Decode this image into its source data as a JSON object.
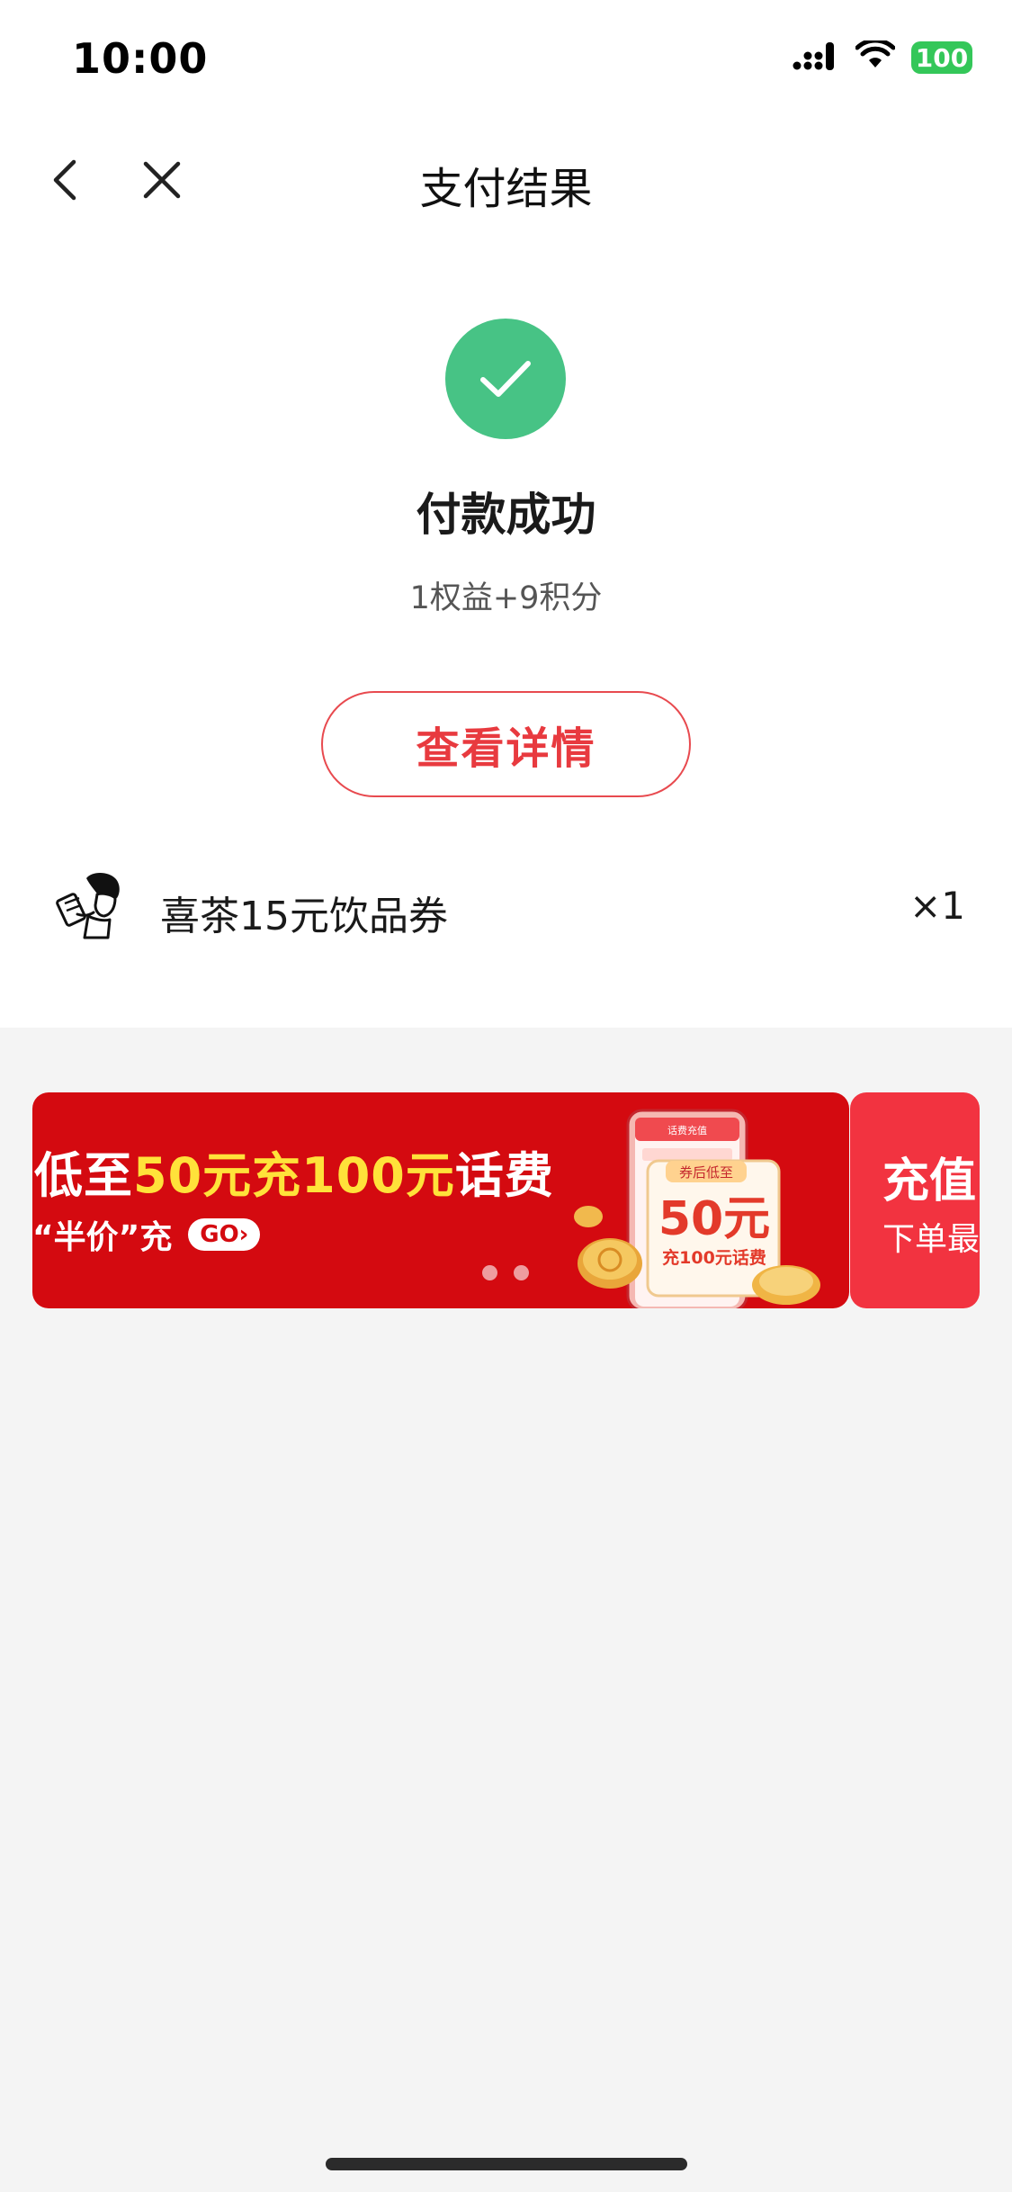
{
  "status_bar": {
    "time": "10:00",
    "battery": "100",
    "colors": {
      "battery": "#34c759"
    },
    "icons": [
      "signal-icon",
      "wifi-icon",
      "battery-icon"
    ]
  },
  "nav": {
    "title": "支付结果",
    "icons": [
      "back-icon",
      "close-icon"
    ]
  },
  "result": {
    "title": "付款成功",
    "subtitle": "1权益+9积分",
    "detail_button": "查看详情",
    "colors": {
      "success": "#47c385",
      "accent": "#e83a3f"
    },
    "icon": "check-icon"
  },
  "reward": {
    "name": "喜茶15元饮品券",
    "count": "×1",
    "icon": "drink-person-icon"
  },
  "banner": {
    "headline_prefix": "低至",
    "headline_highlight": "50元充100元",
    "headline_suffix": "话费",
    "subline": "“半价”充",
    "go_label": "GO›",
    "card_header": "话费充值",
    "card_tag": "券后低至",
    "card_price": "50元",
    "card_desc": "充100元话费",
    "colors": {
      "background": "#d40a10",
      "highlight": "#ffe23a"
    },
    "pagination": {
      "count": 2
    }
  },
  "banner_next": {
    "title": "充值",
    "subtitle": "下单最",
    "colors": {
      "background": "#f23340"
    }
  }
}
